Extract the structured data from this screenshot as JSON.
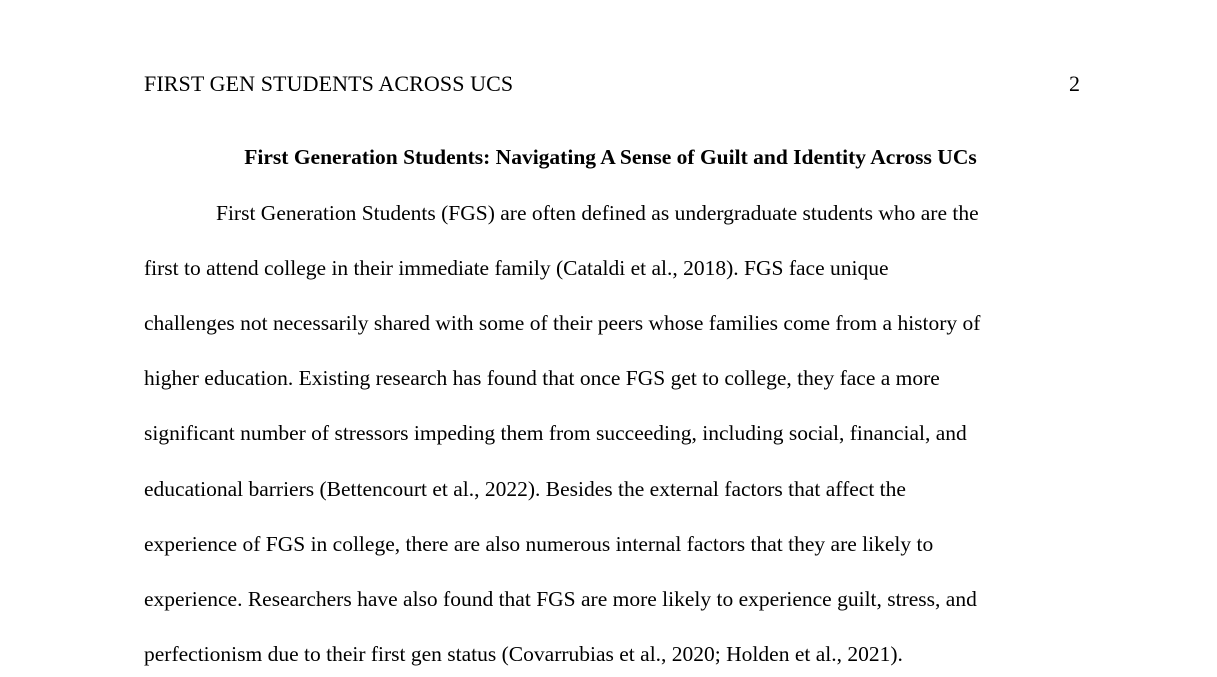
{
  "header": {
    "running_head": "FIRST GEN STUDENTS ACROSS UCS",
    "page_number": "2"
  },
  "document": {
    "title": "First Generation Students: Navigating A Sense of Guilt and Identity Across UCs",
    "paragraph_lines": [
      "First Generation Students (FGS) are often defined as undergraduate students who are the",
      "first to attend college in their immediate family (Cataldi et al., 2018). FGS face unique",
      "challenges not necessarily shared with some of their peers whose families come from a history of",
      "higher education. Existing research has found that once FGS get to college, they face a more",
      "significant number of stressors impeding them from succeeding, including social, financial, and",
      "educational barriers (Bettencourt et al., 2022). Besides the external factors that affect the",
      "experience of FGS in college, there are also numerous internal factors that they are likely to",
      "experience. Researchers have also found that FGS are more likely to experience guilt, stress, and",
      "perfectionism due to their first gen status (Covarrubias et al., 2020; Holden et al., 2021)."
    ]
  }
}
